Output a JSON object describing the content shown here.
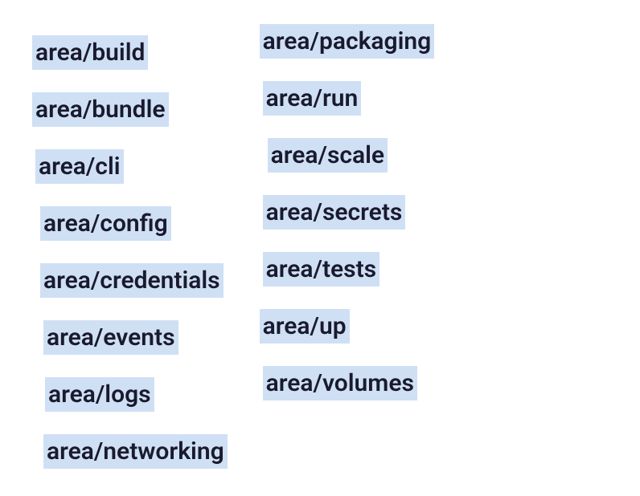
{
  "labels": {
    "left": [
      {
        "text": "area/build",
        "indent": ""
      },
      {
        "text": "area/bundle",
        "indent": ""
      },
      {
        "text": "area/cli",
        "indent": "indent-1"
      },
      {
        "text": "area/config",
        "indent": "indent-2"
      },
      {
        "text": "area/credentials",
        "indent": "indent-2"
      },
      {
        "text": "area/events",
        "indent": "indent-3"
      },
      {
        "text": "area/logs",
        "indent": "indent-4"
      },
      {
        "text": "area/networking",
        "indent": "indent-3"
      }
    ],
    "right": [
      {
        "text": "area/packaging",
        "indent": ""
      },
      {
        "text": "area/run",
        "indent": "indent-1"
      },
      {
        "text": "area/scale",
        "indent": "indent-2"
      },
      {
        "text": "area/secrets",
        "indent": "indent-1"
      },
      {
        "text": "area/tests",
        "indent": "indent-1"
      },
      {
        "text": "area/up",
        "indent": ""
      },
      {
        "text": "area/volumes",
        "indent": "indent-1"
      }
    ]
  }
}
